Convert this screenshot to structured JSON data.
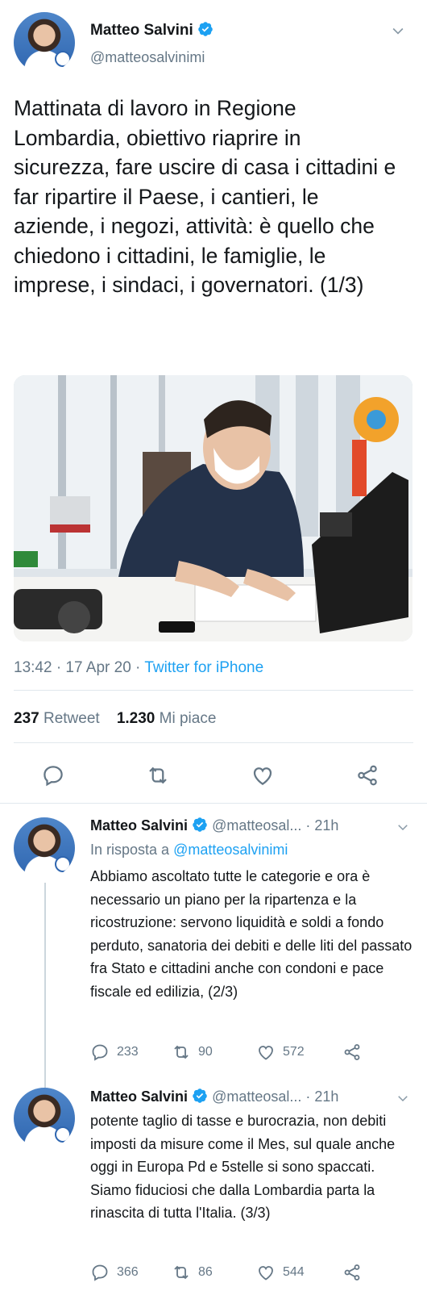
{
  "main_tweet": {
    "name": "Matteo Salvini",
    "handle": "@matteosalvinimi",
    "text": "Mattinata di lavoro in Regione Lombardia, obiettivo riaprire in sicurezza, fare uscire di casa i cittadini e far ripartire il Paese, i cantieri, le aziende, i negozi, attività: è quello che chiedono i cittadini, le famiglie, le imprese, i sindaci, i governatori. (1/3)",
    "time": "13:42 · 17 Apr 20 · ",
    "source": "Twitter for iPhone",
    "retweets_count": "237",
    "retweets_label": "Retweet",
    "likes_count": "1.230",
    "likes_label": "Mi piace"
  },
  "replies": [
    {
      "name": "Matteo Salvini",
      "handle": "@matteosal...",
      "time": "· 21h",
      "reply_to_label": "In risposta a ",
      "reply_to_handle": "@matteosalvinimi",
      "text": "Abbiamo ascoltato tutte le categorie e ora è necessario un piano per la ripartenza e la ricostruzione: servono liquidità e soldi a fondo perduto, sanatoria dei debiti e delle liti del passato fra Stato e cittadini anche con condoni e pace fiscale ed edilizia, (2/3)",
      "replies": "233",
      "retweets": "90",
      "likes": "572"
    },
    {
      "name": "Matteo Salvini",
      "handle": "@matteosal...",
      "time": "· 21h",
      "text": "potente taglio di tasse e burocrazia, non debiti imposti da misure come il Mes, sul quale anche oggi in Europa Pd e 5stelle si sono spaccati. Siamo fiduciosi che dalla Lombardia parta la rinascita di tutta l'Italia. (3/3)",
      "replies": "366",
      "retweets": "86",
      "likes": "544"
    }
  ],
  "colors": {
    "accent": "#1da1f2",
    "muted": "#657786",
    "text": "#14171a",
    "divider": "#e1e8ed"
  },
  "icons": [
    "verified-badge-icon",
    "chevron-down-icon",
    "reply-icon",
    "retweet-icon",
    "like-icon",
    "share-icon"
  ]
}
